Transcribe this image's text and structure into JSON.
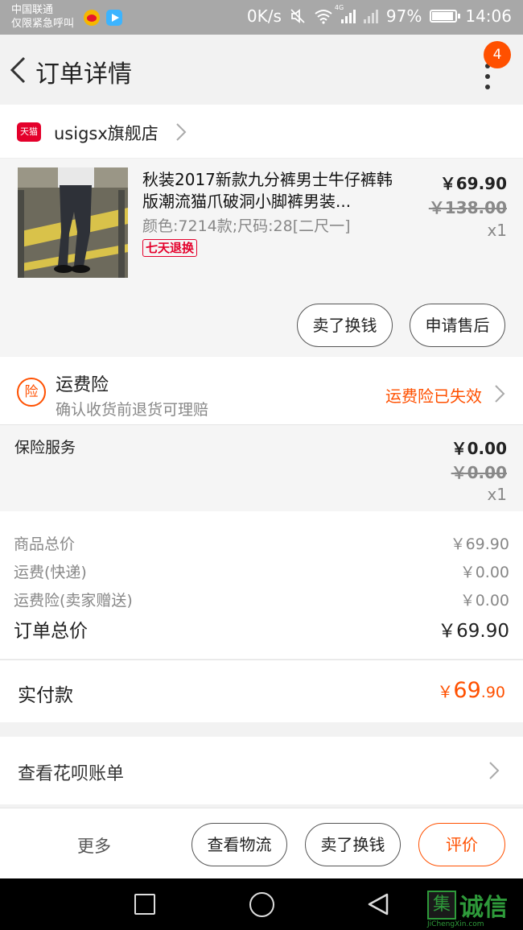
{
  "status_bar": {
    "carrier_line1": "中国联通",
    "carrier_line2": "仅限紧急呼叫",
    "net_speed": "0K/s",
    "signal_label": "4G",
    "battery": "97%",
    "time": "14:06"
  },
  "header": {
    "title": "订单详情",
    "badge_count": "4"
  },
  "shop": {
    "logo_text": "天猫",
    "name": "usigsx旗舰店"
  },
  "product": {
    "title": "秋装2017新款九分裤男士牛仔裤韩版潮流猫爪破洞小脚裤男装...",
    "spec": "颜色:7214款;尺码:28[二尺一]",
    "tag": "七天退换",
    "price": "￥69.90",
    "original_price": "￥138.00",
    "quantity": "x1"
  },
  "product_actions": {
    "sell_label": "卖了换钱",
    "after_sale_label": "申请售后"
  },
  "shipping_insurance": {
    "icon_text": "险",
    "title": "运费险",
    "subtitle": "确认收货前退货可理赔",
    "status": "运费险已失效"
  },
  "insurance_service": {
    "label": "保险服务",
    "price": "￥0.00",
    "original_price": "￥0.00",
    "quantity": "x1"
  },
  "summary": {
    "items_total_label": "商品总价",
    "items_total": "￥69.90",
    "shipping_label": "运费(快递)",
    "shipping": "￥0.00",
    "insurance_label": "运费险(卖家赠送)",
    "insurance": "￥0.00",
    "order_total_label": "订单总价",
    "order_total": "￥69.90"
  },
  "payment": {
    "label": "实付款",
    "currency": "￥",
    "amount_int": "69",
    "amount_dec": ".90"
  },
  "huabei": {
    "label": "查看花呗账单"
  },
  "bottom_bar": {
    "more_label": "更多",
    "logistics_label": "查看物流",
    "sell_label": "卖了换钱",
    "review_label": "评价"
  },
  "watermark": {
    "box_text": "集",
    "text": "诚信",
    "sub": "JiChengXin.com"
  },
  "colors": {
    "accent": "#ff5000",
    "tmall_red": "#e4002b",
    "statusbar": "#a8a8a8"
  }
}
